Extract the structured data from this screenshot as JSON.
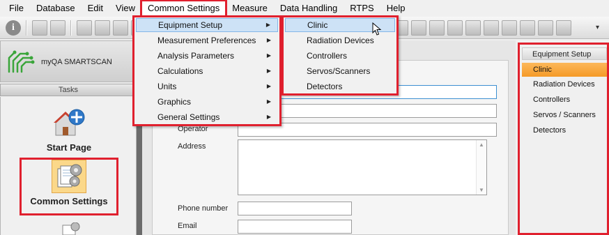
{
  "menubar": {
    "items": [
      {
        "label": "File"
      },
      {
        "label": "Database"
      },
      {
        "label": "Edit"
      },
      {
        "label": "View"
      },
      {
        "label": "Common Settings"
      },
      {
        "label": "Measure"
      },
      {
        "label": "Data Handling"
      },
      {
        "label": "RTPS"
      },
      {
        "label": "Help"
      }
    ]
  },
  "app": {
    "name": "myQA SMARTSCAN"
  },
  "tasks": {
    "header": "Tasks",
    "items": [
      {
        "label": "Start Page"
      },
      {
        "label": "Common Settings"
      }
    ]
  },
  "common_settings_menu": {
    "items": [
      {
        "label": "Equipment Setup"
      },
      {
        "label": "Measurement Preferences"
      },
      {
        "label": "Analysis Parameters"
      },
      {
        "label": "Calculations"
      },
      {
        "label": "Units"
      },
      {
        "label": "Graphics"
      },
      {
        "label": "General Settings"
      }
    ]
  },
  "equipment_submenu": {
    "items": [
      {
        "label": "Clinic"
      },
      {
        "label": "Radiation Devices"
      },
      {
        "label": "Controllers"
      },
      {
        "label": "Servos/Scanners"
      },
      {
        "label": "Detectors"
      }
    ]
  },
  "form": {
    "operator_label": "Operator",
    "address_label": "Address",
    "phone_label": "Phone number",
    "email_label": "Email"
  },
  "right_panel": {
    "header": "Equipment Setup",
    "items": [
      {
        "label": "Clinic"
      },
      {
        "label": "Radiation Devices"
      },
      {
        "label": "Controllers"
      },
      {
        "label": "Servos / Scanners"
      },
      {
        "label": "Detectors"
      }
    ]
  },
  "colors": {
    "highlight_frame": "#e0202e",
    "selected_orange": "#f59a27",
    "menu_hover": "#cde2f6"
  }
}
